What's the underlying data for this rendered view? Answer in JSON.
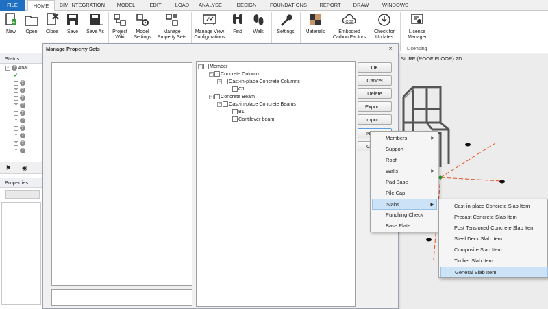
{
  "tabs": [
    "FILE",
    "HOME",
    "BIM INTEGRATION",
    "MODEL",
    "EDIT",
    "LOAD",
    "ANALYSE",
    "DESIGN",
    "FOUNDATIONS",
    "REPORT",
    "DRAW",
    "WINDOWS"
  ],
  "ribbon": {
    "new": "New",
    "open": "Open",
    "close": "Close",
    "save": "Save",
    "save_as": "Save As",
    "project_wiki": [
      "Project",
      "Wiki"
    ],
    "model_settings": [
      "Model",
      "Settings"
    ],
    "manage_property_sets": [
      "Manage",
      "Property Sets"
    ],
    "manage_view_configs": [
      "Manage View",
      "Configurations"
    ],
    "find": "Find",
    "walk": "Walk",
    "settings": "Settings",
    "materials": "Materials",
    "embodied_carbon": [
      "Embodied",
      "Carbon Factors"
    ],
    "check_updates": [
      "Check for",
      "Updates"
    ],
    "license_manager": [
      "License",
      "Manager"
    ],
    "licensing_group": "Licensing"
  },
  "left": {
    "status_header": "Status",
    "status_root": "Anal",
    "properties_header": "Properties"
  },
  "viewport": {
    "title": "St. RF (ROOF FLOOR) 2D"
  },
  "dialog": {
    "title": "Manage Property Sets",
    "close": "×",
    "buttons": {
      "ok": "OK",
      "cancel": "Cancel",
      "delete": "Delete",
      "export": "Export...",
      "import": "Import...",
      "new": "N",
      "copy": "C"
    },
    "tree": {
      "member": "Member",
      "concrete_column": "Concrete Column",
      "cip_columns": "Cast-in-place Concrete Columns",
      "c1": "C1",
      "concrete_beam": "Concrete Beam",
      "cip_beams": "Cast-in-place Concrete Beams",
      "b1": "B1",
      "cantilever": "Cantilever beam"
    }
  },
  "menu1": [
    {
      "label": "Members",
      "arrow": true
    },
    {
      "label": "Support",
      "arrow": false
    },
    {
      "label": "Roof",
      "arrow": false
    },
    {
      "label": "Walls",
      "arrow": true
    },
    {
      "label": "Pad Base",
      "arrow": false
    },
    {
      "label": "Pile Cap",
      "arrow": false
    },
    {
      "label": "Slabs",
      "arrow": true,
      "highlighted": true
    },
    {
      "label": "Punching Check",
      "arrow": false
    },
    {
      "label": "Base Plate",
      "arrow": false
    }
  ],
  "menu2": [
    {
      "label": "Cast-in-place Concrete Slab Item"
    },
    {
      "label": "Precast Concrete Slab Item"
    },
    {
      "label": "Post Tensioned Concrete Slab Item"
    },
    {
      "label": "Steel Deck Slab Item"
    },
    {
      "label": "Composite Slab Item"
    },
    {
      "label": "Timber Slab Item"
    },
    {
      "label": "General Slab Item",
      "highlighted": true
    }
  ],
  "colors": {
    "file_tab": "#1f6fc3",
    "highlight": "#cce2f7"
  }
}
